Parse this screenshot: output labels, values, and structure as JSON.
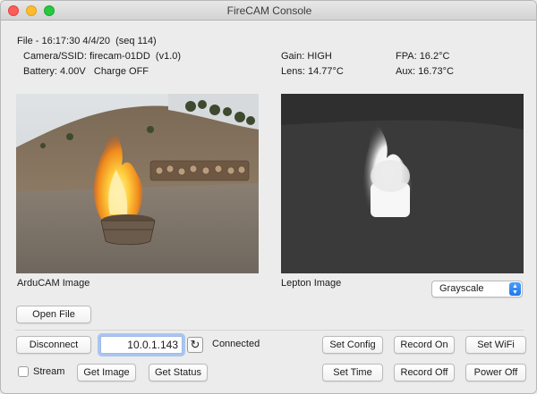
{
  "window": {
    "title": "FireCAM Console"
  },
  "info": {
    "file_line": "File - 16:17:30 4/4/20  (seq 114)",
    "camera_line": "Camera/SSID: firecam-01DD  (v1.0)",
    "battery_line": "Battery: 4.00V   Charge OFF",
    "gain": "Gain: HIGH",
    "lens": "Lens: 14.77°C",
    "fpa": "FPA: 16.2°C",
    "aux": "Aux: 16.73°C"
  },
  "images": {
    "arducam_caption": "ArduCAM Image",
    "lepton_caption": "Lepton Image",
    "palette_selected": "Grayscale"
  },
  "controls": {
    "open_file": "Open File",
    "disconnect": "Disconnect",
    "ip_address": "10.0.1.143",
    "connection_status": "Connected",
    "set_config": "Set Config",
    "record_on": "Record On",
    "set_wifi": "Set WiFi",
    "stream_label": "Stream",
    "stream_checked": false,
    "get_image": "Get Image",
    "get_status": "Get Status",
    "set_time": "Set Time",
    "record_off": "Record Off",
    "power_off": "Power Off"
  },
  "colors": {
    "ip_focus_ring": "#a8c6f2",
    "select_arrow": "#1f76f0",
    "window_bg": "#ececec"
  }
}
